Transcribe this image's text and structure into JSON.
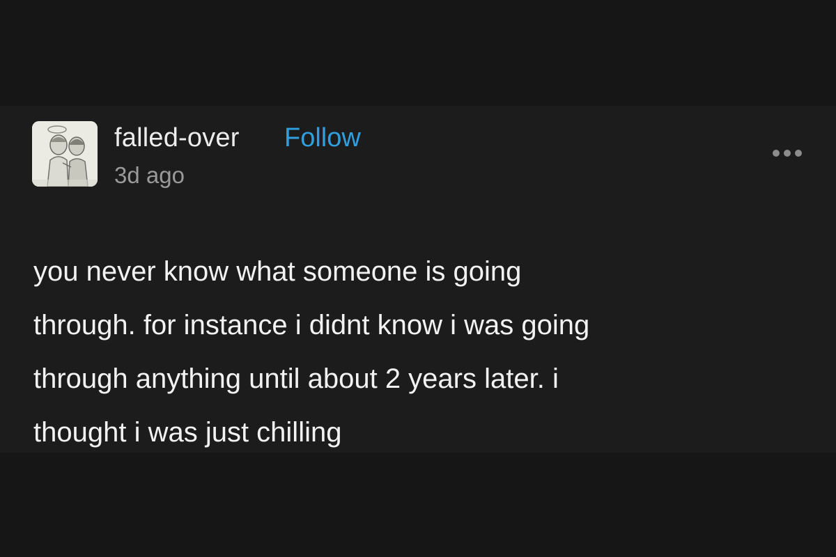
{
  "post": {
    "username": "falled-over",
    "follow_label": "Follow",
    "timestamp": "3d ago",
    "more_icon": "ellipsis-icon",
    "avatar_icon": "avatar-drawing",
    "text": "you never know what someone is going\nthrough. for instance i didnt know i was going\nthrough anything until about 2 years later. i\nthought i was just chilling"
  },
  "colors": {
    "background": "#161616",
    "post_background": "#1c1c1c",
    "text": "#f2f2f2",
    "follow": "#2f9fe0",
    "muted": "#9a9a9a"
  }
}
